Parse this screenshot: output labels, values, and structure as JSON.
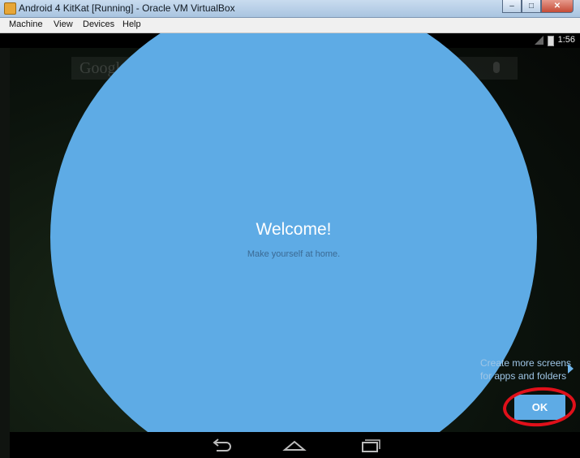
{
  "window": {
    "title": "Android 4 KitKat [Running] - Oracle VM VirtualBox"
  },
  "menubar": {
    "items": [
      "Machine",
      "View",
      "Devices",
      "Help"
    ]
  },
  "status": {
    "time": "1:56"
  },
  "search": {
    "logo_text": "Google"
  },
  "cling": {
    "title": "Welcome!",
    "subtitle": "Make yourself at home."
  },
  "hint": {
    "line1": "Create more screens",
    "line2": "for apps and folders"
  },
  "ok_button": {
    "label": "OK"
  },
  "colors": {
    "cling_blue": "#5eabe5",
    "annotation_red": "#e0101a"
  },
  "icons": [
    "back-icon",
    "home-icon",
    "recents-icon",
    "battery-icon",
    "signal-icon",
    "mic-icon"
  ]
}
